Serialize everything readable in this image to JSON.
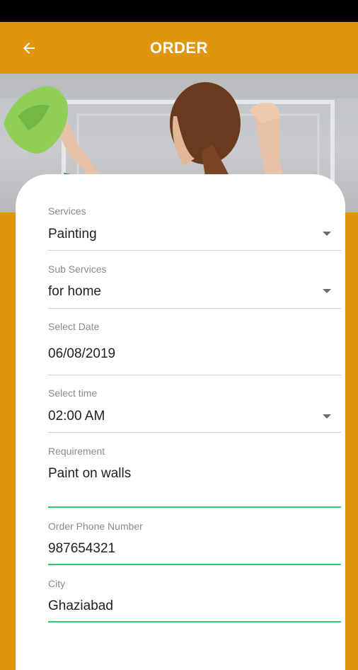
{
  "app_bar": {
    "title": "ORDER",
    "back_icon": "arrow-left-icon"
  },
  "colors": {
    "accent": "#E0950F",
    "focus_underline": "#2ECC71"
  },
  "form": {
    "services": {
      "label": "Services",
      "value": "Painting"
    },
    "sub_services": {
      "label": "Sub Services",
      "value": "for home"
    },
    "select_date": {
      "label": "Select Date",
      "value": "06/08/2019"
    },
    "select_time": {
      "label": "Select time",
      "value": "02:00 AM"
    },
    "requirement": {
      "label": "Requirement",
      "value": "Paint on walls"
    },
    "phone": {
      "label": "Order Phone Number",
      "value": "987654321"
    },
    "city": {
      "label": "City",
      "value": "Ghaziabad"
    }
  }
}
